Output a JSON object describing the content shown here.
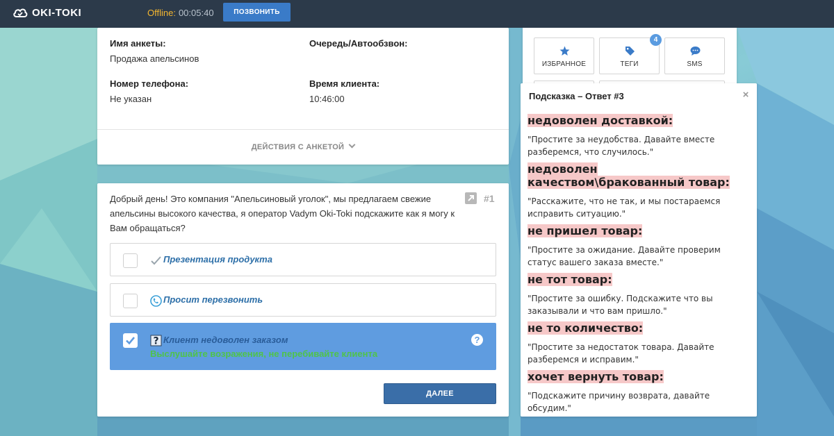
{
  "topbar": {
    "logo_text": "OKI-TOKI",
    "status_label": "Offline:",
    "status_timer": "00:05:40",
    "call_button": "ПОЗВОНИТЬ"
  },
  "info": {
    "name_label": "Имя анкеты:",
    "name_value": "Продажа апельсинов",
    "queue_label": "Очередь/Автообзвон:",
    "phone_label": "Номер телефона:",
    "phone_value": "Не указан",
    "time_label": "Время клиента:",
    "time_value": "10:46:00",
    "actions_label": "ДЕЙСТВИЯ С АНКЕТОЙ"
  },
  "script": {
    "text": "Добрый день! Это компания \"Апельсиновый уголок\", мы предлагаем свежие апельсины высокого качества, я оператор Vadym Oki-Toki подскажите как я могу к Вам обращаться?",
    "number": "#1",
    "options": [
      {
        "label": "Презентация продукта",
        "icon": "check-mark-icon",
        "checked": false
      },
      {
        "label": "Просит перезвонить",
        "icon": "phone-icon",
        "checked": false
      },
      {
        "label": "Клиент недоволен заказом",
        "icon": "question-icon",
        "checked": true,
        "sub": "Выслушайте возражения, не перебивайте клиента"
      }
    ],
    "next_button": "ДАЛЕЕ"
  },
  "tools": {
    "favorites": "ИЗБРАННОЕ",
    "tags": "ТЕГИ",
    "tags_count": "4",
    "sms": "SMS"
  },
  "hint": {
    "title": "Подсказка – Ответ #3",
    "items": [
      {
        "heading": "недоволен доставкой:",
        "text": "\"Простите за неудобства. Давайте вместе разберемся, что случилось.\""
      },
      {
        "heading": "недоволен качеством\\бракованный товар:",
        "text": "\"Расскажите, что не так, и мы постараемся исправить ситуацию.\""
      },
      {
        "heading": "не пришел товар:",
        "text": "\"Простите за ожидание. Давайте проверим статус вашего заказа вместе.\""
      },
      {
        "heading": "не тот товар:",
        "text": "\"Простите за ошибку. Подскажите что вы заказывали и что вам пришло.\""
      },
      {
        "heading": "не то количество:",
        "text": "\"Простите за недостаток товара. Давайте разберемся и исправим.\""
      },
      {
        "heading": "хочет вернуть товар:",
        "text": "\"Подскажите причину возврата, давайте обсудим.\""
      }
    ]
  },
  "colors": {
    "topbar": "#2c3a4a",
    "accent_blue": "#3a7bc8",
    "selected_option": "#5f9ce0",
    "hint_highlight": "#f6c8c8",
    "offline": "#f4b630",
    "success_text": "#4fc34a"
  }
}
